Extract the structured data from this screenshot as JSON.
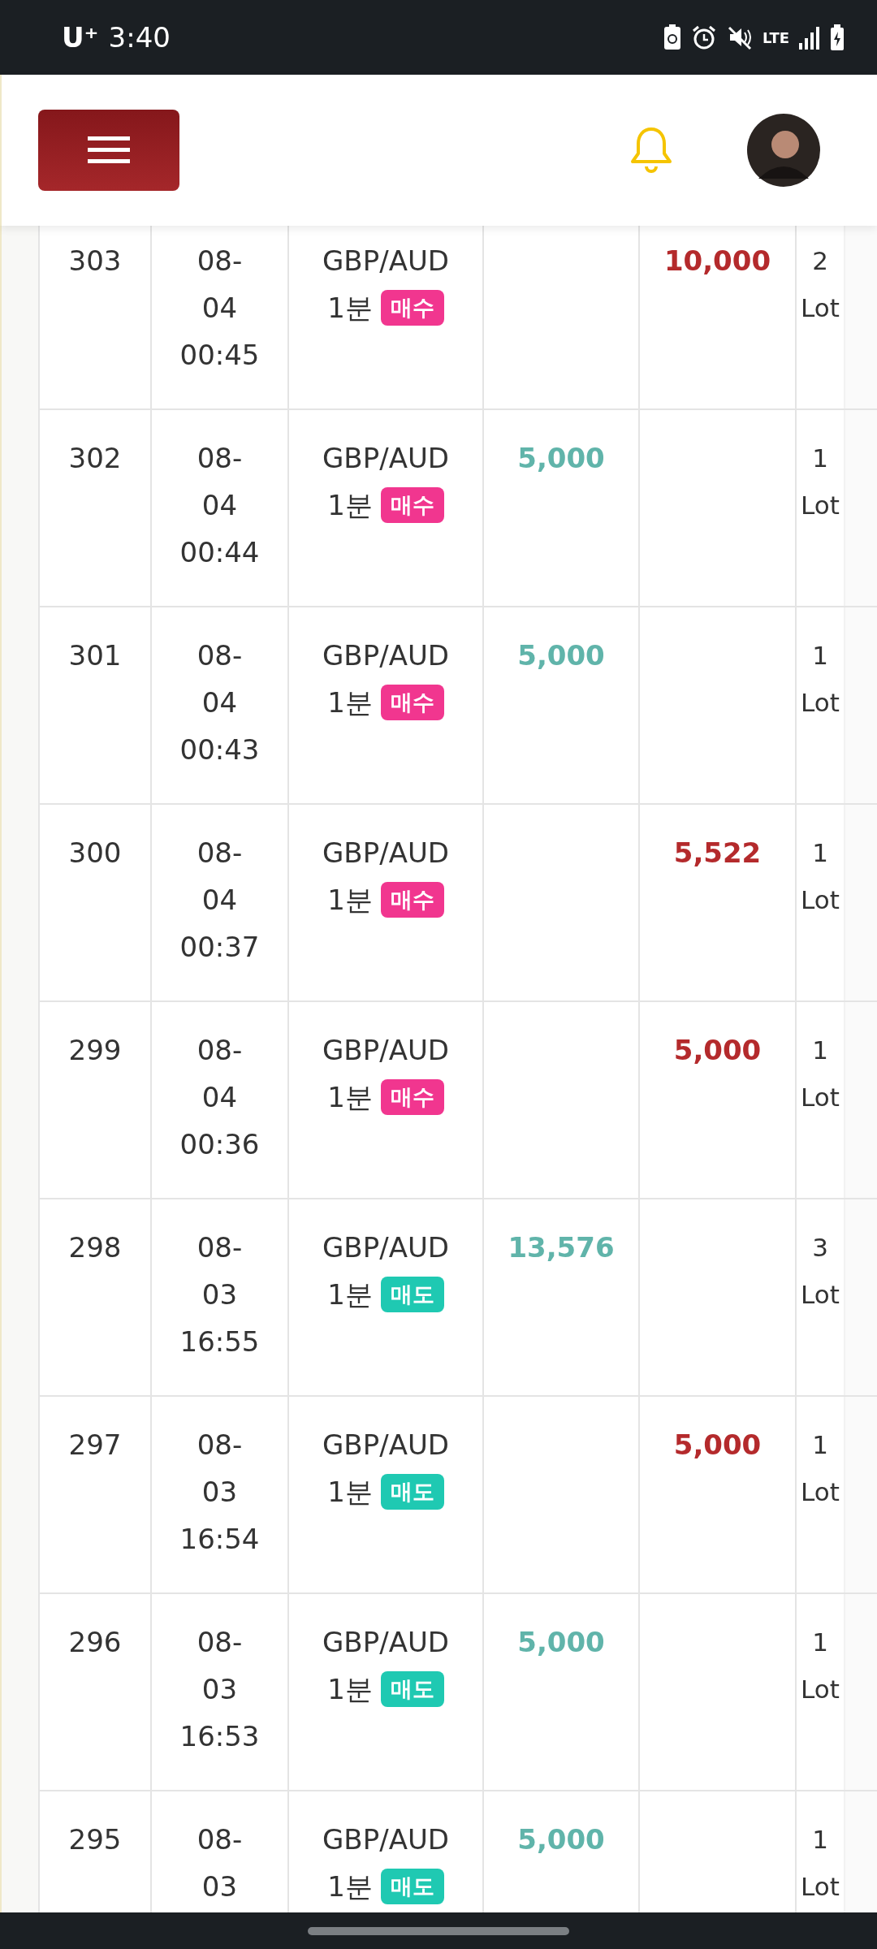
{
  "status_bar": {
    "carrier": "U⁺",
    "time": "3:40",
    "network": "LTE"
  },
  "rows": [
    {
      "no": "303",
      "datetime": [
        "08-",
        "04",
        "00:45"
      ],
      "pair": "GBP/AUD",
      "period": "1분",
      "side": {
        "kind": "buy",
        "label": "매수"
      },
      "loss": "10,000",
      "lots": "2 Lot"
    },
    {
      "no": "302",
      "datetime": [
        "08-",
        "04",
        "00:44"
      ],
      "pair": "GBP/AUD",
      "period": "1분",
      "side": {
        "kind": "buy",
        "label": "매수"
      },
      "profit": "5,000",
      "lots": "1 Lot"
    },
    {
      "no": "301",
      "datetime": [
        "08-",
        "04",
        "00:43"
      ],
      "pair": "GBP/AUD",
      "period": "1분",
      "side": {
        "kind": "buy",
        "label": "매수"
      },
      "profit": "5,000",
      "lots": "1 Lot"
    },
    {
      "no": "300",
      "datetime": [
        "08-",
        "04",
        "00:37"
      ],
      "pair": "GBP/AUD",
      "period": "1분",
      "side": {
        "kind": "buy",
        "label": "매수"
      },
      "loss": "5,522",
      "lots": "1 Lot"
    },
    {
      "no": "299",
      "datetime": [
        "08-",
        "04",
        "00:36"
      ],
      "pair": "GBP/AUD",
      "period": "1분",
      "side": {
        "kind": "buy",
        "label": "매수"
      },
      "loss": "5,000",
      "lots": "1 Lot"
    },
    {
      "no": "298",
      "datetime": [
        "08-",
        "03",
        "16:55"
      ],
      "pair": "GBP/AUD",
      "period": "1분",
      "side": {
        "kind": "sell",
        "label": "매도"
      },
      "profit": "13,576",
      "lots": "3 Lot"
    },
    {
      "no": "297",
      "datetime": [
        "08-",
        "03",
        "16:54"
      ],
      "pair": "GBP/AUD",
      "period": "1분",
      "side": {
        "kind": "sell",
        "label": "매도"
      },
      "loss": "5,000",
      "lots": "1 Lot"
    },
    {
      "no": "296",
      "datetime": [
        "08-",
        "03",
        "16:53"
      ],
      "pair": "GBP/AUD",
      "period": "1분",
      "side": {
        "kind": "sell",
        "label": "매도"
      },
      "profit": "5,000",
      "lots": "1 Lot"
    },
    {
      "no": "295",
      "datetime": [
        "08-",
        "03"
      ],
      "pair": "GBP/AUD",
      "period": "1분",
      "side": {
        "kind": "sell",
        "label": "매도"
      },
      "profit": "5,000",
      "lots": "1 Lot"
    }
  ]
}
